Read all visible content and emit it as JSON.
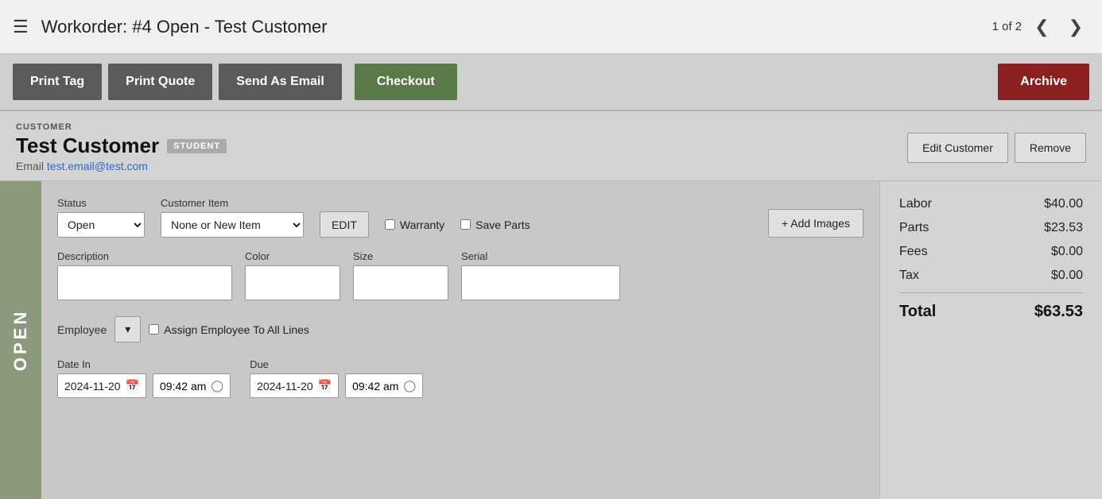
{
  "header": {
    "title": "Workorder: #4 Open - Test Customer",
    "page_indicator": "1 of 2"
  },
  "toolbar": {
    "print_tag": "Print Tag",
    "print_quote": "Print Quote",
    "send_as_email": "Send As Email",
    "checkout": "Checkout",
    "archive": "Archive"
  },
  "customer": {
    "section_label": "CUSTOMER",
    "name": "Test Customer",
    "badge": "STUDENT",
    "email_label": "Email",
    "email": "test.email@test.com",
    "edit_button": "Edit Customer",
    "remove_button": "Remove"
  },
  "workorder": {
    "side_label": "OPEN",
    "status_label": "Status",
    "status_value": "Open",
    "customer_item_label": "Customer Item",
    "customer_item_value": "None or New Item",
    "edit_button": "EDIT",
    "warranty_label": "Warranty",
    "save_parts_label": "Save Parts",
    "add_images_button": "+ Add Images",
    "description_label": "Description",
    "color_label": "Color",
    "size_label": "Size",
    "serial_label": "Serial",
    "employee_label": "Employee",
    "assign_label": "Assign Employee To All Lines",
    "date_in_label": "Date In",
    "date_in_value": "2024-11-20",
    "date_in_time": "09:42 am",
    "due_label": "Due",
    "due_date_value": "2024-11-20",
    "due_time": "09:42 am"
  },
  "summary": {
    "labor_label": "Labor",
    "labor_value": "$40.00",
    "parts_label": "Parts",
    "parts_value": "$23.53",
    "fees_label": "Fees",
    "fees_value": "$0.00",
    "tax_label": "Tax",
    "tax_value": "$0.00",
    "total_label": "Total",
    "total_value": "$63.53"
  },
  "icons": {
    "hamburger": "☰",
    "chevron_left": "❮",
    "chevron_right": "❯",
    "calendar": "📅",
    "clock": "🕐",
    "dropdown": "▾"
  }
}
